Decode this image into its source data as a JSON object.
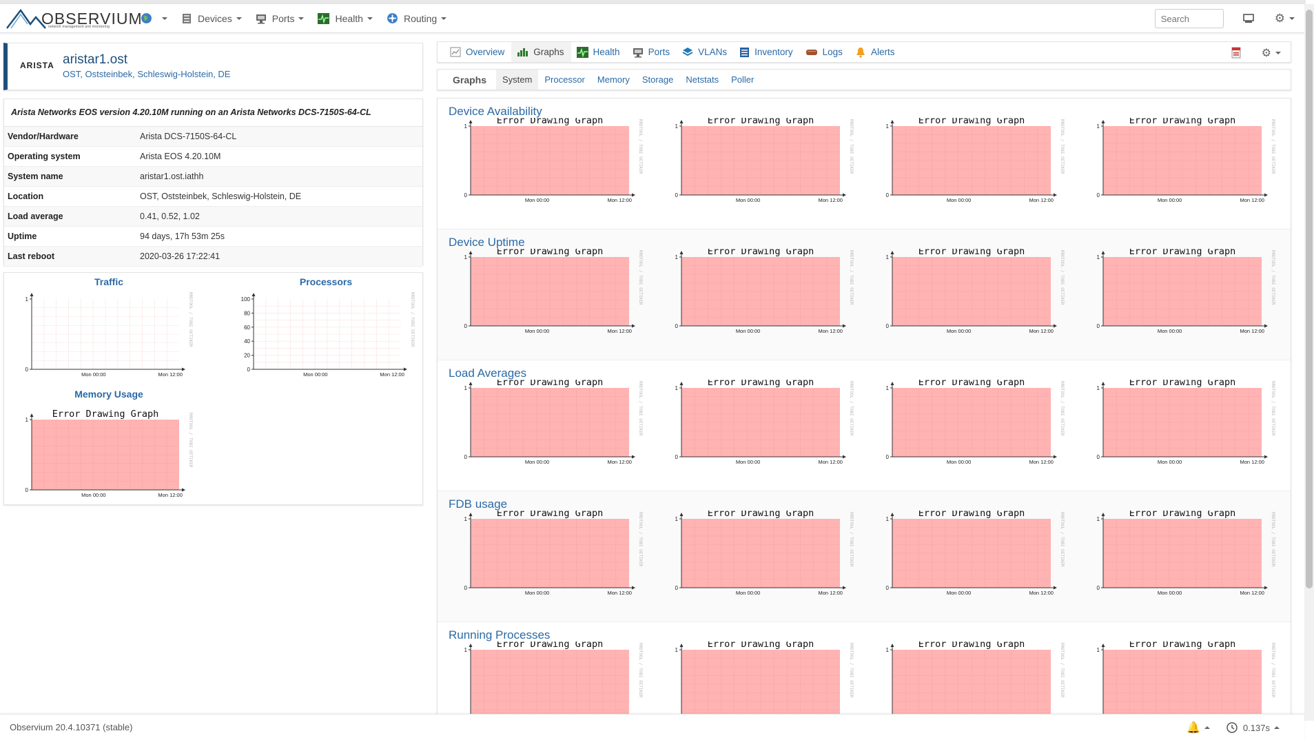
{
  "navbar": {
    "brand": "OBSERVIUM",
    "brand_sub": "network management and monitoring",
    "items": [
      {
        "label": "",
        "icon": "globe-icon"
      },
      {
        "label": "Devices",
        "icon": "server-icon"
      },
      {
        "label": "Ports",
        "icon": "network-port-icon"
      },
      {
        "label": "Health",
        "icon": "heartbeat-icon"
      },
      {
        "label": "Routing",
        "icon": "routing-icon"
      }
    ],
    "search_placeholder": "Search"
  },
  "device": {
    "vendor_logo": "ARISTA",
    "name": "aristar1.ost",
    "location": "OST, Oststeinbek, Schleswig-Holstein, DE"
  },
  "info": {
    "title": "Arista Networks EOS version 4.20.10M running on an Arista Networks DCS-7150S-64-CL",
    "rows": [
      {
        "key": "Vendor/Hardware",
        "value": "Arista DCS-7150S-64-CL"
      },
      {
        "key": "Operating system",
        "value": "Arista EOS 4.20.10M"
      },
      {
        "key": "System name",
        "value": "aristar1.ost.iathh"
      },
      {
        "key": "Location",
        "value": "OST, Oststeinbek, Schleswig-Holstein, DE"
      },
      {
        "key": "Load average",
        "value": "0.41, 0.52, 1.02"
      },
      {
        "key": "Uptime",
        "value": "94 days, 17h 53m 25s"
      },
      {
        "key": "Last reboot",
        "value": "2020-03-26 17:22:41"
      }
    ]
  },
  "mini_graphs": [
    {
      "title": "Traffic",
      "y_ticks": [
        "1",
        "0"
      ],
      "x_ticks": [
        "Mon 00:00",
        "Mon 12:00"
      ],
      "error": ""
    },
    {
      "title": "Processors",
      "y_ticks": [
        "100",
        "80",
        "60",
        "40",
        "20",
        "0"
      ],
      "x_ticks": [
        "Mon 00:00",
        "Mon 12:00"
      ],
      "error": ""
    },
    {
      "title": "Memory Usage",
      "y_ticks": [
        "1",
        "0"
      ],
      "x_ticks": [
        "Mon 00:00",
        "Mon 12:00"
      ],
      "error": "Error Drawing Graph"
    }
  ],
  "tabs": [
    {
      "label": "Overview",
      "icon": "overview-icon",
      "active": false
    },
    {
      "label": "Graphs",
      "icon": "graphs-icon",
      "active": true
    },
    {
      "label": "Health",
      "icon": "heartbeat-icon",
      "active": false
    },
    {
      "label": "Ports",
      "icon": "network-port-icon",
      "active": false
    },
    {
      "label": "VLANs",
      "icon": "vlans-icon",
      "active": false
    },
    {
      "label": "Inventory",
      "icon": "inventory-icon",
      "active": false
    },
    {
      "label": "Logs",
      "icon": "logs-icon",
      "active": false
    },
    {
      "label": "Alerts",
      "icon": "bell-icon",
      "active": false
    }
  ],
  "subtabs": {
    "label": "Graphs",
    "items": [
      {
        "label": "System",
        "active": true
      },
      {
        "label": "Processor",
        "active": false
      },
      {
        "label": "Memory",
        "active": false
      },
      {
        "label": "Storage",
        "active": false
      },
      {
        "label": "Netstats",
        "active": false
      },
      {
        "label": "Poller",
        "active": false
      }
    ]
  },
  "graph_common": {
    "error": "Error Drawing Graph",
    "y_top": "1",
    "y_bottom": "0",
    "x_ticks": [
      "Mon 00:00",
      "Mon 12:00"
    ],
    "watermark": "RRDTOOL / TOBI OETIKER"
  },
  "graph_sections": [
    {
      "title": "Device Availability"
    },
    {
      "title": "Device Uptime"
    },
    {
      "title": "Load Averages"
    },
    {
      "title": "FDB usage"
    },
    {
      "title": "Running Processes"
    }
  ],
  "footer": {
    "version": "Observium 20.4.10371 (stable)",
    "timing": "0.137s"
  },
  "colors": {
    "accent": "#2a6aa6",
    "header_bar": "#1e4f7a",
    "error_fill": "#ffb3b3",
    "grid": "#f3c6c6"
  }
}
